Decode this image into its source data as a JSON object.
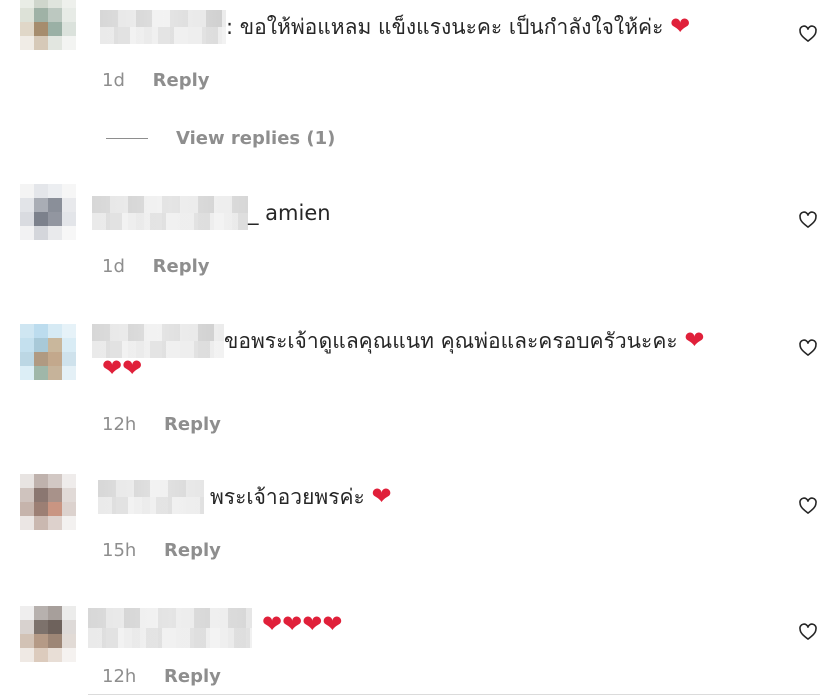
{
  "comments": [
    {
      "text": ": ขอให้พ่อแหลม แข็งแรงนะคะ เป็นกำลังใจให้ค่ะ",
      "hearts_inline": "❤",
      "time": "1d",
      "reply": "Reply"
    },
    {
      "text": "_ amien",
      "time": "1d",
      "reply": "Reply"
    },
    {
      "text": "ขอพระเจ้าดูแลคุณแนท คุณพ่อและครอบครัวนะคะ",
      "hearts_inline": "❤",
      "hearts_line2": "❤❤",
      "time": "12h",
      "reply": "Reply"
    },
    {
      "text": "พระเจ้าอวยพรค่ะ",
      "hearts_inline": "❤",
      "time": "15h",
      "reply": "Reply"
    },
    {
      "hearts_inline": "❤❤❤❤",
      "time": "12h",
      "reply": "Reply"
    }
  ],
  "view_replies": "View replies (1)",
  "colors": {
    "heart": "#e0203a",
    "meta": "#8e8e8e",
    "text": "#262626"
  },
  "icons": {
    "like": "heart-outline-icon"
  }
}
